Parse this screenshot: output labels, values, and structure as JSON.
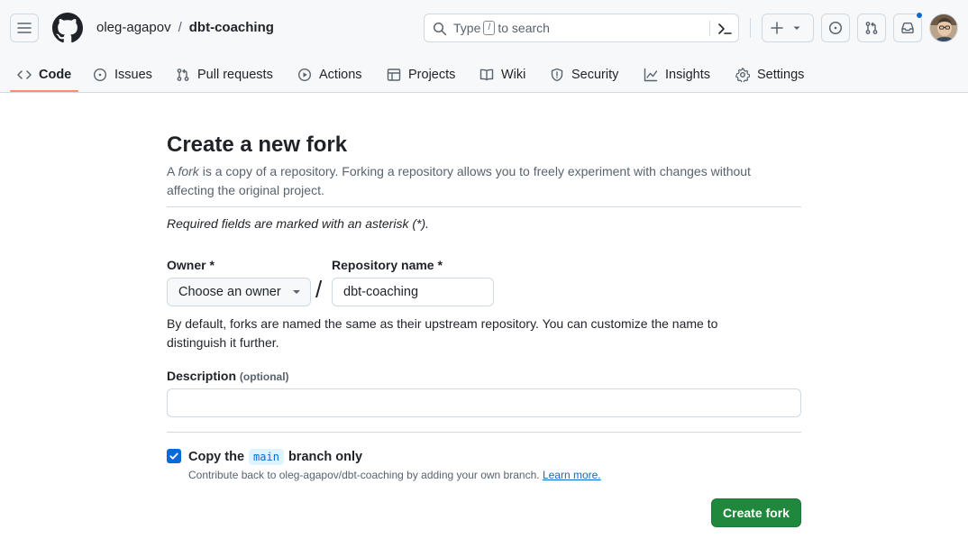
{
  "header": {
    "owner": "oleg-agapov",
    "separator": "/",
    "repo": "dbt-coaching",
    "search": {
      "prefix": "Type",
      "key": "/",
      "suffix": "to search"
    },
    "icons": [
      "hamburger-icon",
      "github-logo-icon",
      "search-icon",
      "command-palette-icon",
      "plus-icon",
      "triangle-down-icon",
      "issue-opened-icon",
      "git-pull-request-icon",
      "inbox-icon"
    ],
    "notification_color": "#0969da"
  },
  "tabs": [
    {
      "label": "Code",
      "icon": "code-icon",
      "active": true
    },
    {
      "label": "Issues",
      "icon": "issue-opened-icon"
    },
    {
      "label": "Pull requests",
      "icon": "git-pull-request-icon"
    },
    {
      "label": "Actions",
      "icon": "play-icon"
    },
    {
      "label": "Projects",
      "icon": "table-icon"
    },
    {
      "label": "Wiki",
      "icon": "book-icon"
    },
    {
      "label": "Security",
      "icon": "shield-icon"
    },
    {
      "label": "Insights",
      "icon": "graph-icon"
    },
    {
      "label": "Settings",
      "icon": "gear-icon"
    }
  ],
  "form": {
    "title": "Create a new fork",
    "subtitle_pre": "A ",
    "subtitle_em": "fork",
    "subtitle_post": " is a copy of a repository. Forking a repository allows you to freely experiment with changes without affecting the original project.",
    "required_note": "Required fields are marked with an asterisk (*).",
    "owner_label": "Owner *",
    "owner_value": "Choose an owner",
    "slash": "/",
    "repo_label": "Repository name *",
    "repo_value": "dbt-coaching",
    "help": "By default, forks are named the same as their upstream repository. You can customize the name to distinguish it further.",
    "description_label": "Description",
    "description_optional": "(optional)",
    "description_value": "",
    "copy_pre": "Copy the",
    "copy_branch": "main",
    "copy_post": "branch only",
    "copy_checked": true,
    "copy_note": "Contribute back to oleg-agapov/dbt-coaching by adding your own branch.",
    "learn_more": "Learn more.",
    "submit": "Create fork",
    "accent": "#1f883d",
    "link_color": "#0969da"
  }
}
